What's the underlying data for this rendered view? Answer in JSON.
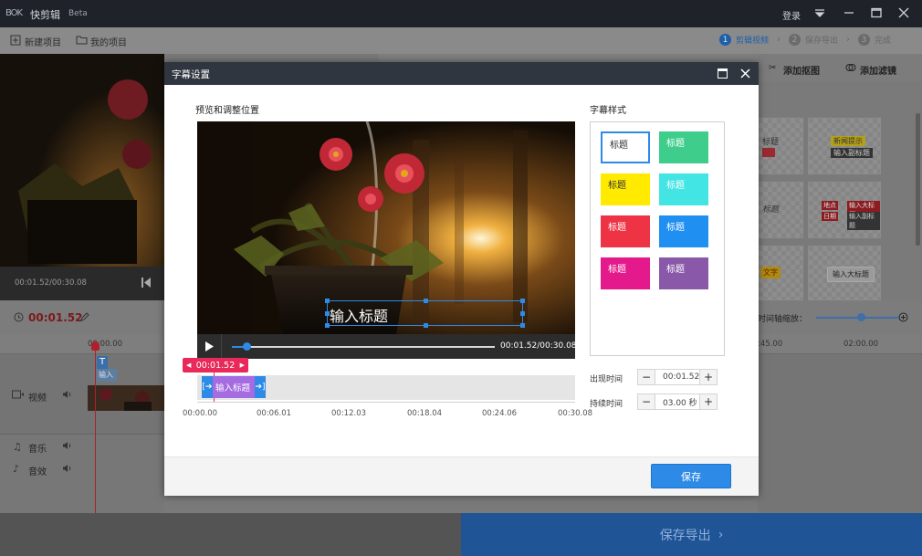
{
  "app": {
    "logo": "BOK",
    "name": "快剪辑",
    "edition": "Beta",
    "login": "登录"
  },
  "toolbar": {
    "new_project": "新建项目",
    "my_projects": "我的项目"
  },
  "steps": [
    {
      "num": "1",
      "label": "剪辑视频"
    },
    {
      "num": "2",
      "label": "保存导出"
    },
    {
      "num": "3",
      "label": "完成"
    }
  ],
  "base": {
    "preview_time": "00:01.52/00:30.08",
    "current_time": "00:01.52",
    "ruler_start": "00:00.00",
    "ruler_right": [
      ":45.00",
      "02:00.00"
    ],
    "clip_text_label": "T",
    "clip_text": "输入",
    "tracks": {
      "video": "视频",
      "music": "音乐",
      "sfx": "音效"
    },
    "right_tools": {
      "matting": "添加抠图",
      "filter": "添加滤镜"
    },
    "zoom_label": "时间轴缩放：",
    "right_cards": [
      "标题",
      "新闻提示",
      "输入副标题",
      "标题",
      "地点",
      "输入大标题",
      "日期",
      "输入副标题",
      "文字",
      "输入大标题"
    ],
    "export": "保存导出"
  },
  "modal": {
    "title": "字幕设置",
    "preview_heading": "预览和调整位置",
    "styles_heading": "字幕样式",
    "caption_text": "输入标题",
    "player_time": "00:01.52/00:30.08",
    "playhead_time": "00:01.52",
    "clip_label": "输入标题",
    "ticks": [
      "00:00.00",
      "00:06.01",
      "00:12.03",
      "00:18.04",
      "00:24.06",
      "00:30.08"
    ],
    "appear_label": "出现时间",
    "appear_value": "00:01.52",
    "duration_label": "持续时间",
    "duration_value": "03.00 秒",
    "swatch_label": "标题",
    "save": "保存"
  },
  "colors": {
    "accent": "#2d8ae6",
    "playhead": "#e8295a",
    "clip": "#a56be0",
    "swatches": [
      "#ffffff",
      "#3fcd8c",
      "#ffea00",
      "#43e4e4",
      "#ee3344",
      "#1f8ff2",
      "#e4198c",
      "#8a58a8"
    ]
  }
}
